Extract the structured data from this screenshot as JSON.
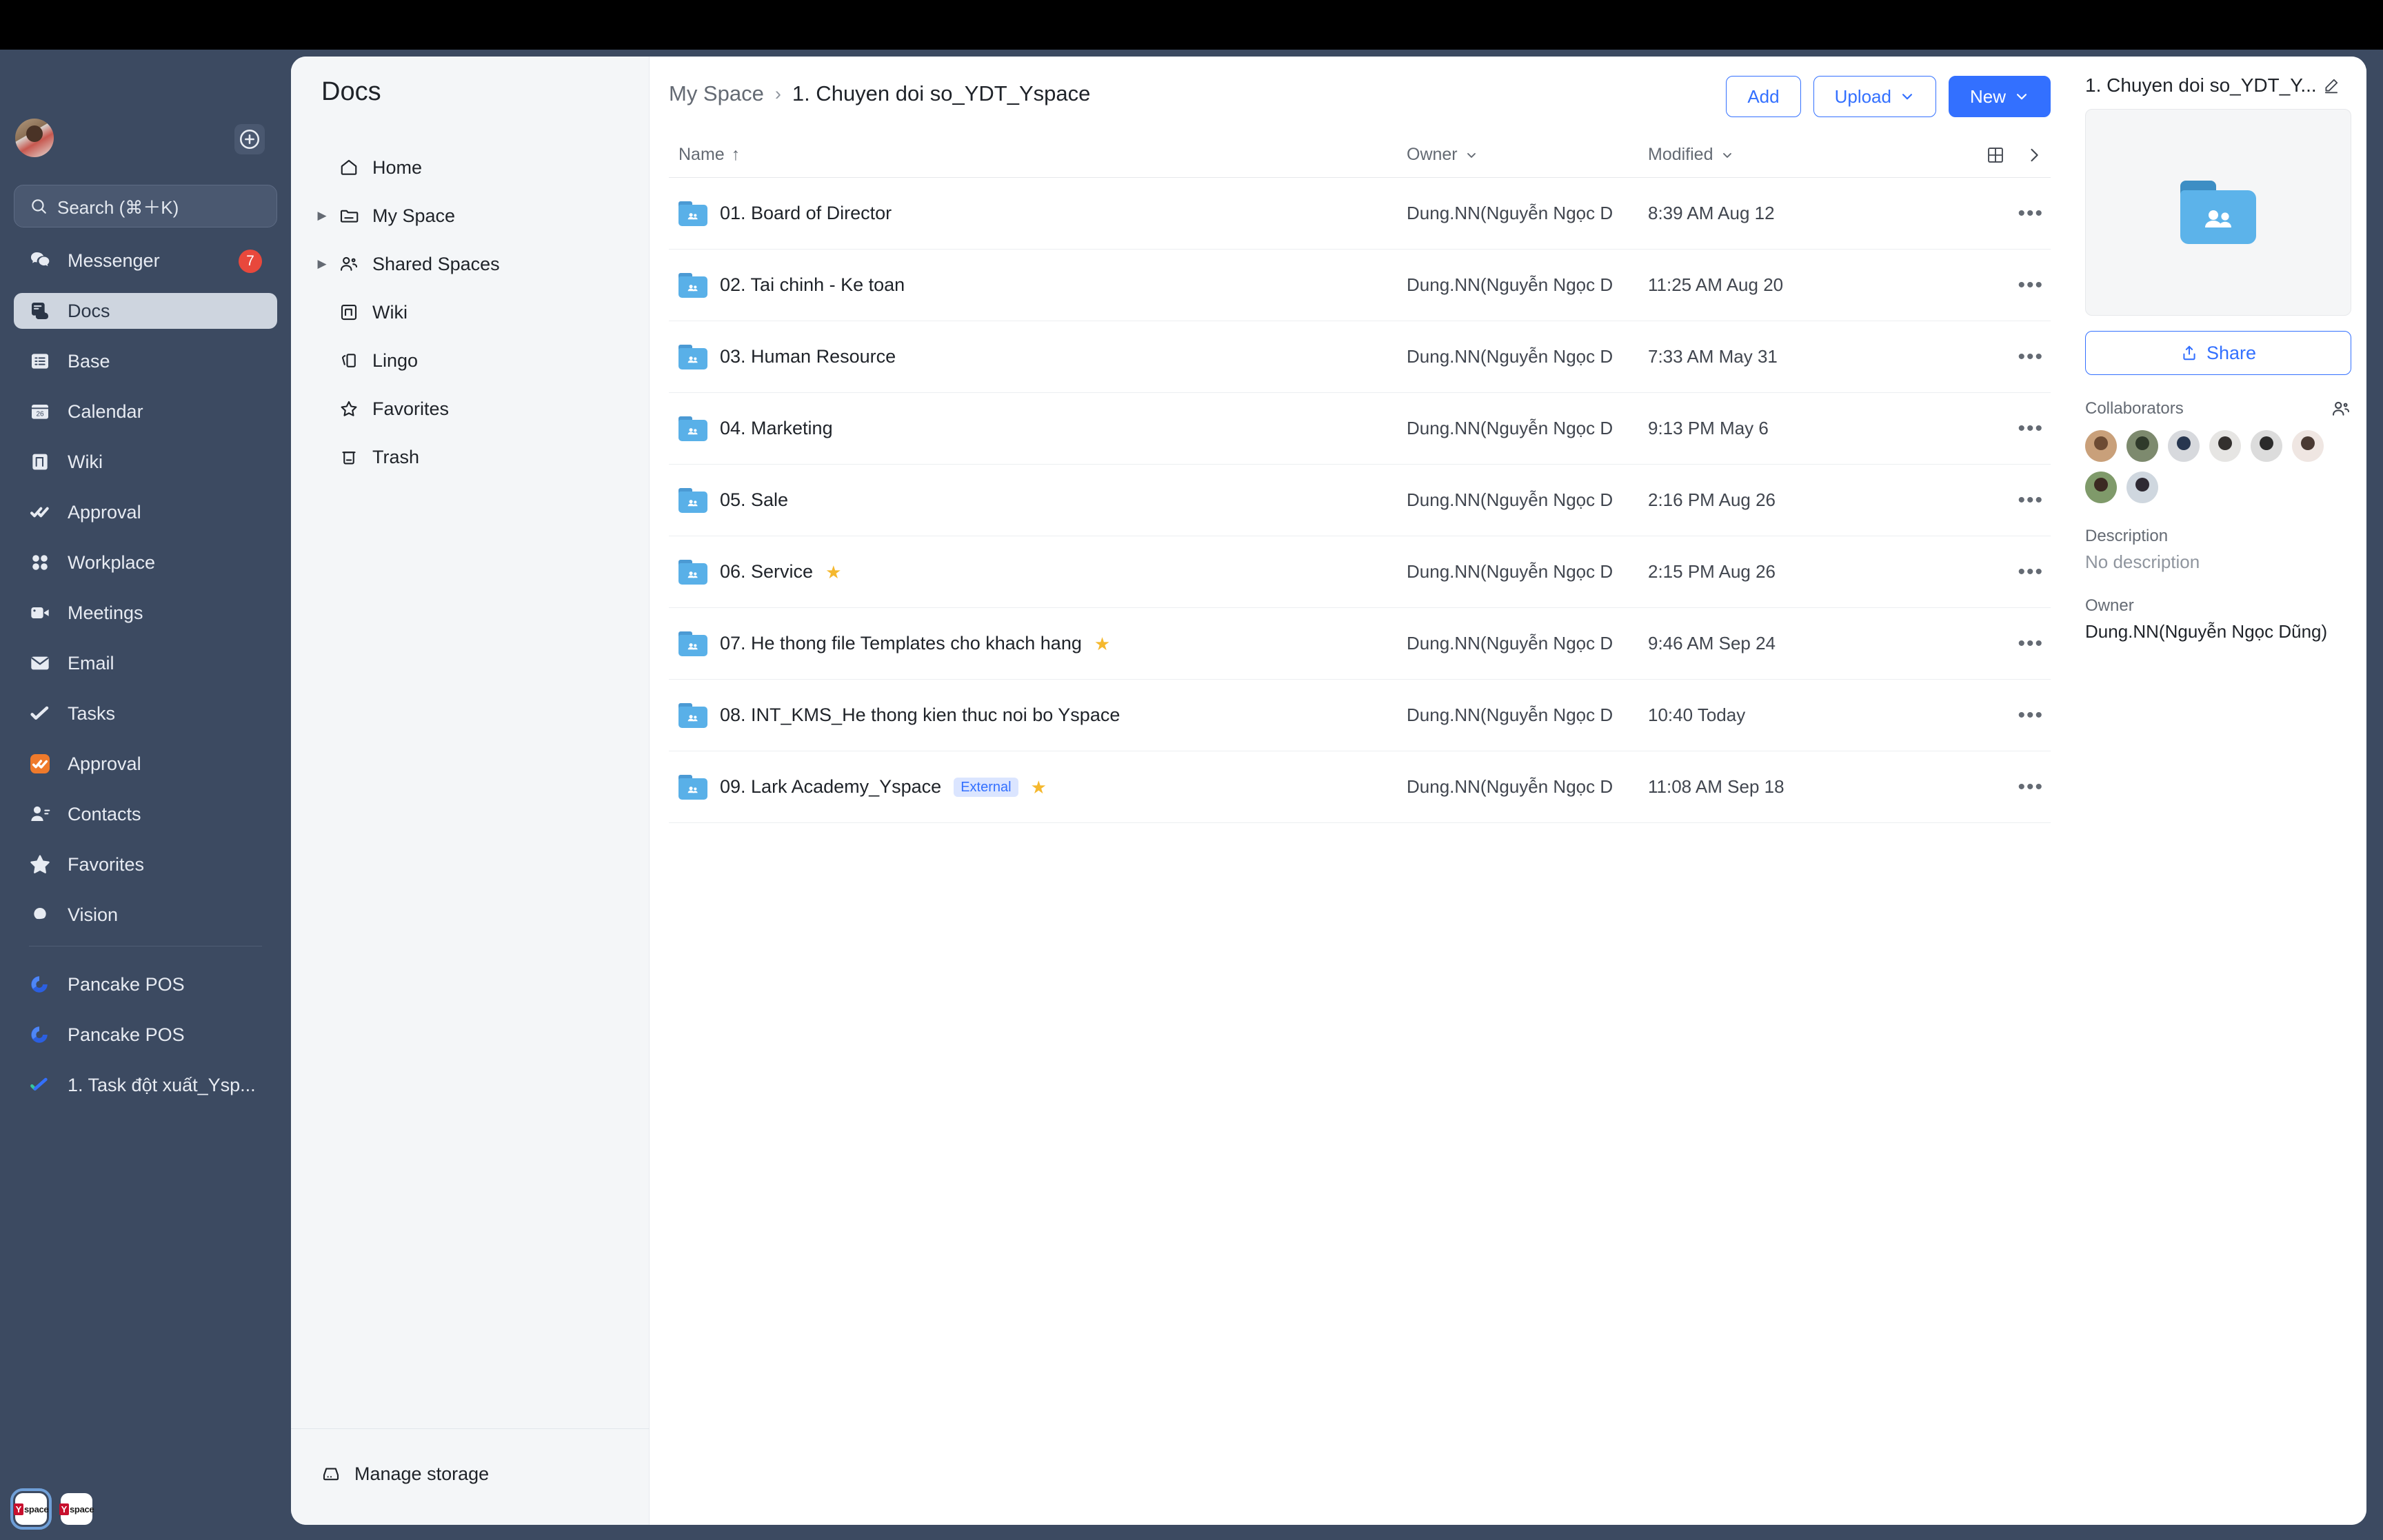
{
  "window": {
    "top_bar_color": "#000000",
    "shell_color": "#3c4a61"
  },
  "rail": {
    "search_placeholder": "Search (⌘＋K)",
    "add_icon": "plus-circle-icon",
    "items": [
      {
        "label": "Messenger",
        "icon": "messenger-icon",
        "badge": "7",
        "active": false
      },
      {
        "label": "Docs",
        "icon": "docs-icon",
        "badge": "",
        "active": true
      },
      {
        "label": "Base",
        "icon": "base-icon",
        "badge": "",
        "active": false
      },
      {
        "label": "Calendar",
        "icon": "calendar-icon",
        "badge": "",
        "active": false
      },
      {
        "label": "Wiki",
        "icon": "wiki-icon",
        "badge": "",
        "active": false
      },
      {
        "label": "Approval",
        "icon": "approval-icon",
        "badge": "",
        "active": false
      },
      {
        "label": "Workplace",
        "icon": "workplace-icon",
        "badge": "",
        "active": false
      },
      {
        "label": "Meetings",
        "icon": "meetings-icon",
        "badge": "",
        "active": false
      },
      {
        "label": "Email",
        "icon": "email-icon",
        "badge": "",
        "active": false
      },
      {
        "label": "Tasks",
        "icon": "tasks-icon",
        "badge": "",
        "active": false
      },
      {
        "label": "Approval",
        "icon": "approval-app-icon",
        "badge": "",
        "active": false
      },
      {
        "label": "Contacts",
        "icon": "contacts-icon",
        "badge": "",
        "active": false
      },
      {
        "label": "Favorites",
        "icon": "star-icon",
        "badge": "",
        "active": false
      },
      {
        "label": "Vision",
        "icon": "vision-icon",
        "badge": "",
        "active": false
      }
    ],
    "pinned": [
      {
        "label": "Pancake POS",
        "icon": "pancake-pos-icon"
      },
      {
        "label": "Pancake POS",
        "icon": "pancake-pos-icon"
      },
      {
        "label": "1. Task đột xuất_Ysp...",
        "icon": "task-icon"
      }
    ],
    "dock": [
      {
        "name": "Yspace",
        "selected": true
      },
      {
        "name": "Yspace",
        "selected": false
      }
    ]
  },
  "docsnav": {
    "title": "Docs",
    "items": [
      {
        "label": "Home",
        "icon": "home-icon",
        "expandable": false
      },
      {
        "label": "My Space",
        "icon": "folder-icon",
        "expandable": true
      },
      {
        "label": "Shared Spaces",
        "icon": "shared-spaces-icon",
        "expandable": true
      },
      {
        "label": "Wiki",
        "icon": "wiki-icon",
        "expandable": false
      },
      {
        "label": "Lingo",
        "icon": "lingo-icon",
        "expandable": false
      },
      {
        "label": "Favorites",
        "icon": "star-outline-icon",
        "expandable": false
      },
      {
        "label": "Trash",
        "icon": "trash-icon",
        "expandable": false
      }
    ],
    "manage_storage": "Manage storage"
  },
  "header": {
    "breadcrumb_parent": "My Space",
    "breadcrumb_separator": "›",
    "breadcrumb_current": "1. Chuyen doi so_YDT_Yspace",
    "add_label": "Add",
    "upload_label": "Upload",
    "new_label": "New"
  },
  "table": {
    "columns": {
      "name": "Name",
      "sort_arrow": "↑",
      "owner": "Owner",
      "modified": "Modified"
    },
    "grid_view_icon": "grid-view-icon",
    "expand_icon": "chevron-right-icon",
    "rows": [
      {
        "name": "01. Board of Director",
        "owner": "Dung.NN(Nguyễn Ngọc D",
        "modified": "8:39 AM Aug 12",
        "starred": false,
        "external": ""
      },
      {
        "name": "02. Tai chinh - Ke toan",
        "owner": "Dung.NN(Nguyễn Ngọc D",
        "modified": "11:25 AM Aug 20",
        "starred": false,
        "external": ""
      },
      {
        "name": "03. Human Resource",
        "owner": "Dung.NN(Nguyễn Ngọc D",
        "modified": "7:33 AM May 31",
        "starred": false,
        "external": ""
      },
      {
        "name": "04. Marketing",
        "owner": "Dung.NN(Nguyễn Ngọc D",
        "modified": "9:13 PM May 6",
        "starred": false,
        "external": ""
      },
      {
        "name": "05. Sale",
        "owner": "Dung.NN(Nguyễn Ngọc D",
        "modified": "2:16 PM Aug 26",
        "starred": false,
        "external": ""
      },
      {
        "name": "06. Service",
        "owner": "Dung.NN(Nguyễn Ngọc D",
        "modified": "2:15 PM Aug 26",
        "starred": true,
        "external": ""
      },
      {
        "name": "07. He thong file Templates cho khach hang",
        "owner": "Dung.NN(Nguyễn Ngọc D",
        "modified": "9:46 AM Sep 24",
        "starred": true,
        "external": ""
      },
      {
        "name": "08. INT_KMS_He thong kien thuc noi bo Yspace",
        "owner": "Dung.NN(Nguyễn Ngọc D",
        "modified": "10:40 Today",
        "starred": false,
        "external": ""
      },
      {
        "name": "09. Lark Academy_Yspace",
        "owner": "Dung.NN(Nguyễn Ngọc D",
        "modified": "11:08 AM Sep 18",
        "starred": true,
        "external": "External"
      }
    ],
    "row_menu_icon": "more-options-icon"
  },
  "detail": {
    "title": "1. Chuyen doi so_YDT_Y...",
    "edit_icon": "pencil-icon",
    "preview_icon": "shared-folder-icon",
    "share_label": "Share",
    "collaborators_label": "Collaborators",
    "add_collaborator_icon": "add-member-icon",
    "collaborator_count": 8,
    "description_label": "Description",
    "description_value": "No description",
    "owner_label": "Owner",
    "owner_value": "Dung.NN(Nguyễn Ngọc Dũng)"
  },
  "colors": {
    "accent": "#3370ff",
    "sidebar": "#3c4a61",
    "badge_red": "#e8483c",
    "folder_blue": "#59b0e8",
    "star_gold": "#f5b82e",
    "external_badge_bg": "#dbe5ff"
  }
}
